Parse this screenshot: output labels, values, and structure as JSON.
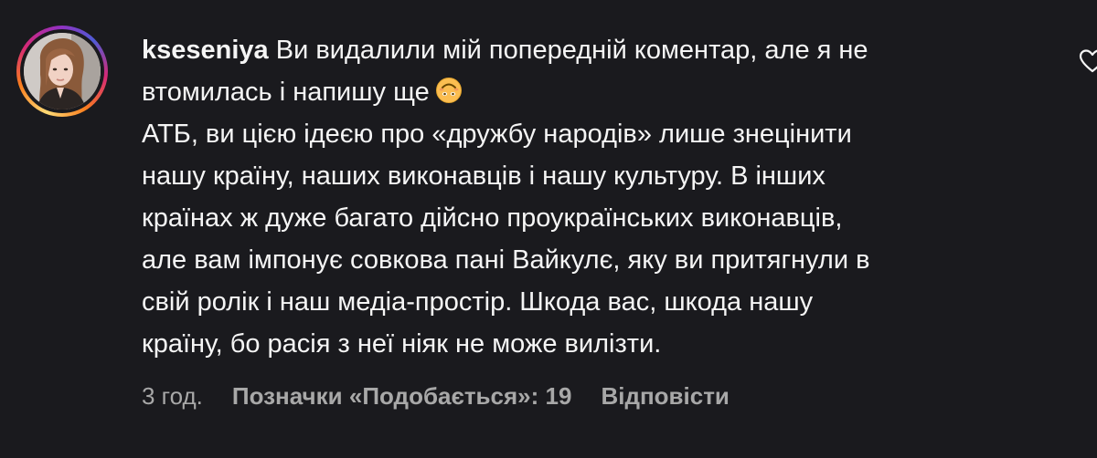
{
  "comment": {
    "username": "kseseniya",
    "line1": "Ви видалили мій попередній коментар, але я не",
    "line2": "втомилась і напишу ще",
    "body": "АТБ, ви цією ідеєю про «дружбу народів» лише знецінити\nнашу країну, наших виконавців і нашу культуру. В інших\nкраїнах ж дуже багато дійсно проукраїнських виконавців,\nале вам імпонує совкова пані Вайкулє, яку ви притягнули в\nсвій ролік і наш медіа-простір. Шкода вас, шкода нашу\nкраїну, бо расія з неї ніяк не може вилізти.",
    "emoji_icon": "upside-down-face-emoji",
    "time": "3 год.",
    "likes": "Позначки «Подобається»: 19",
    "reply": "Відповісти",
    "like_icon": "heart-outline-icon"
  },
  "colors": {
    "background": "#1a1a1e",
    "text": "#f5f5f5",
    "meta": "#a8a8a8"
  }
}
